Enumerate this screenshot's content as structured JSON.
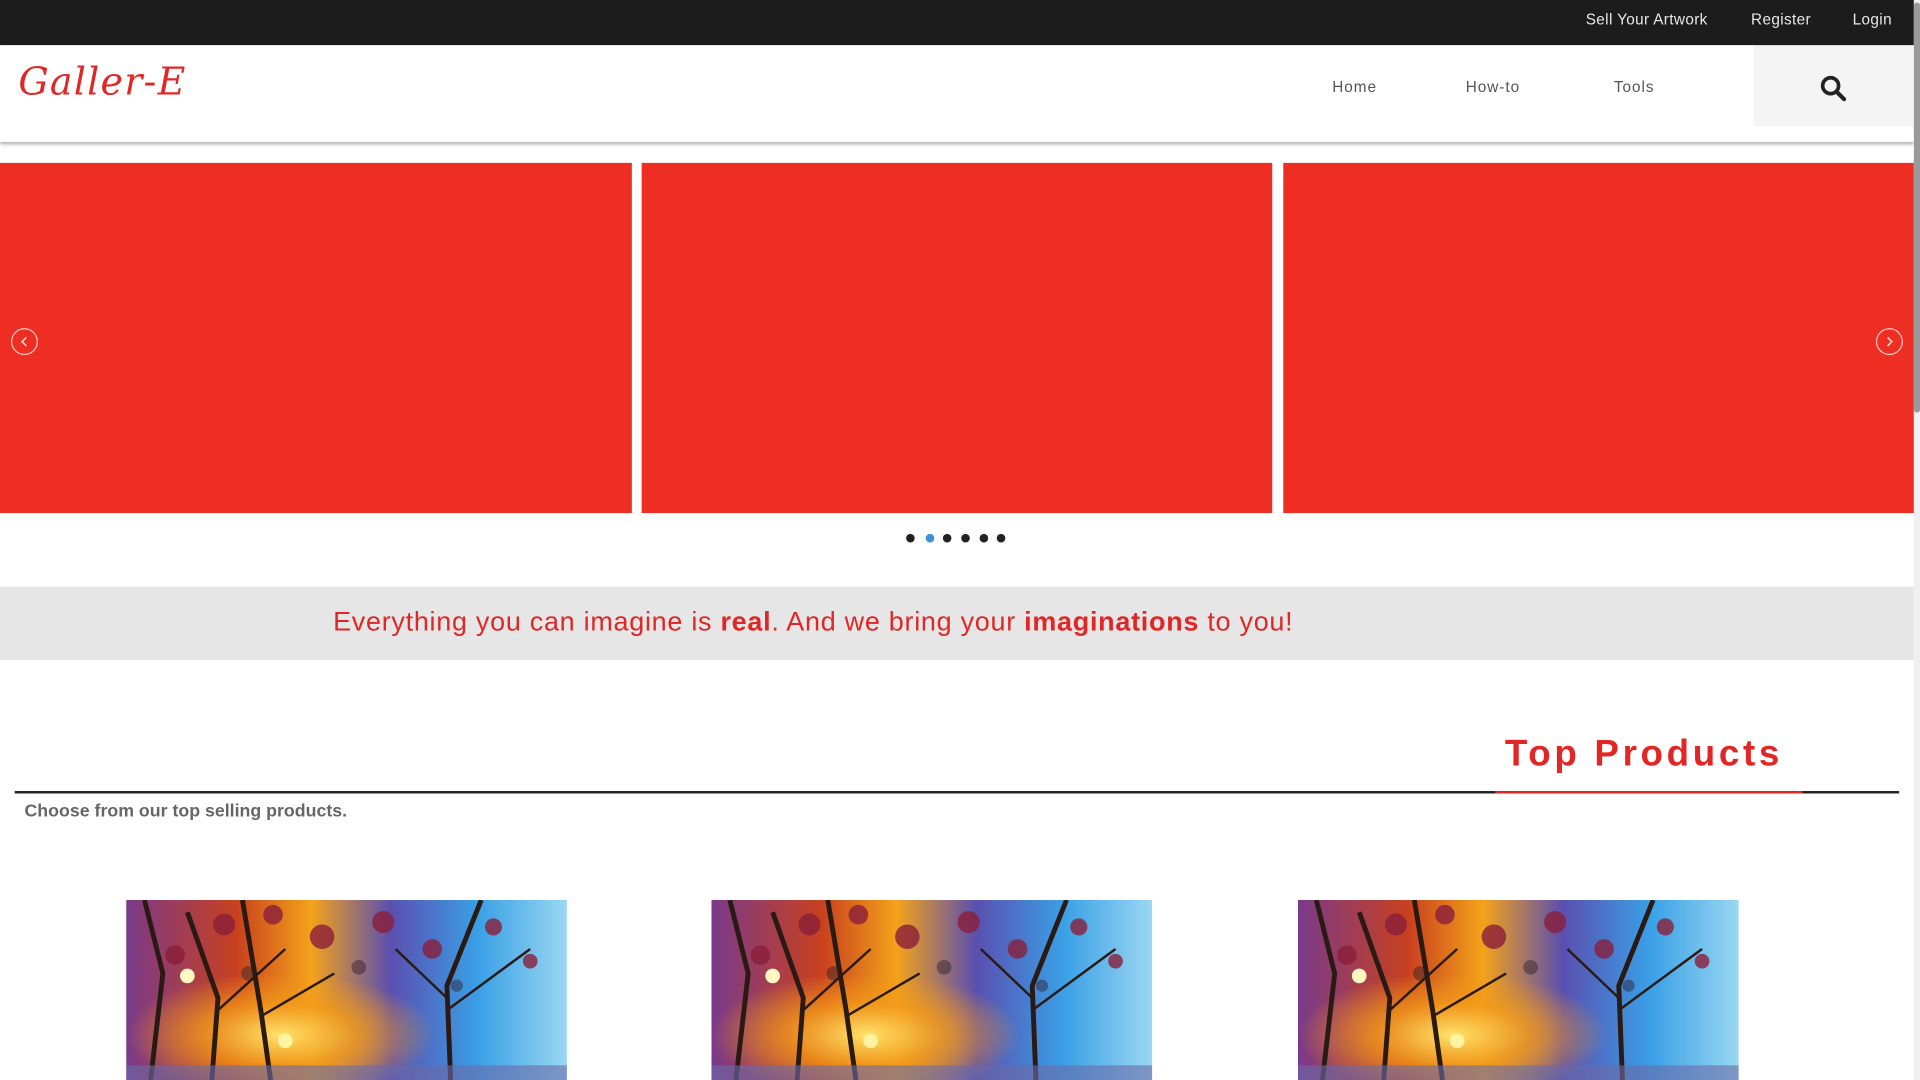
{
  "topbar": {
    "links": [
      {
        "label": "Sell Your Artwork"
      },
      {
        "label": "Register"
      },
      {
        "label": "Login"
      }
    ]
  },
  "header": {
    "logo": "Galler-E",
    "nav": [
      {
        "label": "Home"
      },
      {
        "label": "How-to"
      },
      {
        "label": "Tools"
      }
    ],
    "search_icon": "search-icon"
  },
  "carousel": {
    "slide_color": "#ee2e22",
    "slide_count_visible": 3,
    "dot_count": 6,
    "active_dot": 2,
    "prev_icon": "chevron-left-icon",
    "next_icon": "chevron-right-icon"
  },
  "tagline": {
    "part1": "Everything you can imagine is ",
    "bold1": "real",
    "part2": ". And we bring your ",
    "bold2": "imaginations",
    "part3": " to you!"
  },
  "top_products": {
    "title": "Top Products",
    "subtitle": "Choose from our top selling products.",
    "items": [
      {
        "image": "painting-tree-lamp"
      },
      {
        "image": "painting-tree-lamp"
      },
      {
        "image": "painting-tree-lamp"
      }
    ]
  },
  "colors": {
    "brand_red": "#e22626",
    "topbar_bg": "#1c1c1c",
    "tagline_bg": "#e6e6e6",
    "active_dot": "#3a8fd6"
  }
}
